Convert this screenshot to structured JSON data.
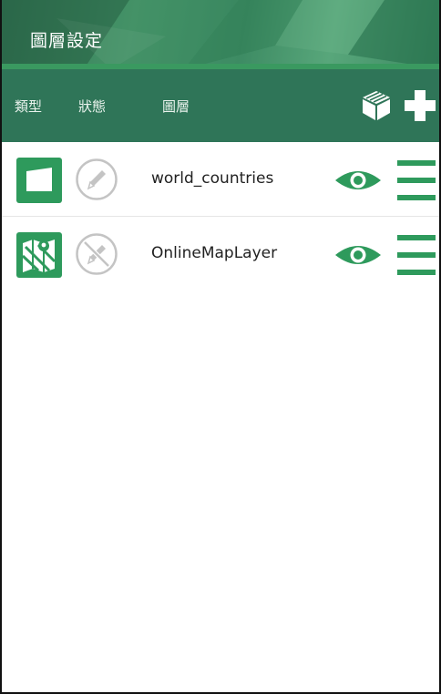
{
  "titlebar": {
    "title": "圖層設定"
  },
  "columns": {
    "type": "類型",
    "state": "狀態",
    "layer": "圖層"
  },
  "layers": [
    {
      "name": "world_countries",
      "type_icon": "polygon-layer-icon",
      "editable": true,
      "visible": true
    },
    {
      "name": "OnlineMapLayer",
      "type_icon": "online-map-icon",
      "editable": false,
      "visible": true
    }
  ],
  "colors": {
    "primary": "#2f7558",
    "accent": "#2e9a5c",
    "icon_gray": "#bdbdbd"
  }
}
